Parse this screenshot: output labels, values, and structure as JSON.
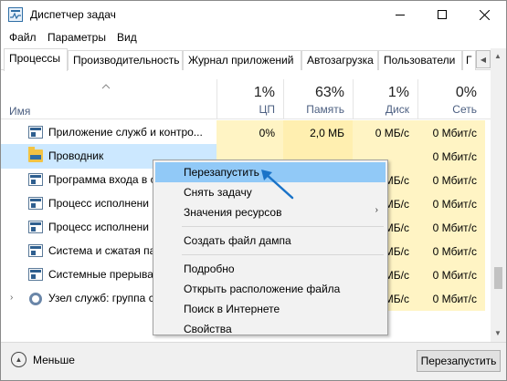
{
  "window": {
    "title": "Диспетчер задач",
    "controls": {
      "minimize": "—",
      "maximize": "☐",
      "close": "✕"
    }
  },
  "menu": {
    "items": [
      "Файл",
      "Параметры",
      "Вид"
    ]
  },
  "tabs": [
    {
      "label": "Процессы",
      "active": true
    },
    {
      "label": "Производительность",
      "active": false
    },
    {
      "label": "Журнал приложений",
      "active": false
    },
    {
      "label": "Автозагрузка",
      "active": false
    },
    {
      "label": "Пользователи",
      "active": false
    },
    {
      "label": "Г",
      "active": false
    }
  ],
  "table": {
    "name_header": "Имя",
    "columns": [
      {
        "pct": "1%",
        "label": "ЦП"
      },
      {
        "pct": "63%",
        "label": "Память"
      },
      {
        "pct": "1%",
        "label": "Диск"
      },
      {
        "pct": "0%",
        "label": "Сеть"
      }
    ],
    "rows": [
      {
        "name": "Приложение служб и контро...",
        "icon": "app-icon",
        "expander": "",
        "cpu": "0%",
        "mem": "2,0 МБ",
        "disk": "0 МБ/с",
        "net": "0 Мбит/с",
        "selected": false
      },
      {
        "name": "Проводник",
        "icon": "folder-icon",
        "expander": "",
        "cpu": "",
        "mem": "",
        "disk": "",
        "net": "0 Мбит/с",
        "selected": true
      },
      {
        "name": "Программа входа в с",
        "icon": "app-icon",
        "expander": "",
        "cpu": "",
        "mem": "",
        "disk": "0 МБ/с",
        "net": "0 Мбит/с",
        "selected": false
      },
      {
        "name": "Процесс исполнени",
        "icon": "app-icon",
        "expander": "",
        "cpu": "",
        "mem": "",
        "disk": "0 МБ/с",
        "net": "0 Мбит/с",
        "selected": false
      },
      {
        "name": "Процесс исполнени",
        "icon": "app-icon",
        "expander": "",
        "cpu": "",
        "mem": "",
        "disk": "0 МБ/с",
        "net": "0 Мбит/с",
        "selected": false
      },
      {
        "name": "Система и сжатая па",
        "icon": "app-icon",
        "expander": "",
        "cpu": "",
        "mem": "",
        "disk": "0 МБ/с",
        "net": "0 Мбит/с",
        "selected": false
      },
      {
        "name": "Системные прерыва",
        "icon": "app-icon",
        "expander": "",
        "cpu": "",
        "mem": "",
        "disk": "0 МБ/с",
        "net": "0 Мбит/с",
        "selected": false
      },
      {
        "name": "Узел служб: группа с",
        "icon": "gear-icon",
        "expander": "›",
        "cpu": "",
        "mem": "",
        "disk": "0 МБ/с",
        "net": "0 Мбит/с",
        "selected": false
      }
    ]
  },
  "context_menu": {
    "items": [
      {
        "label": "Перезапустить",
        "highlighted": true,
        "submenu": false
      },
      {
        "label": "Снять задачу",
        "highlighted": false,
        "submenu": false
      },
      {
        "label": "Значения ресурсов",
        "highlighted": false,
        "submenu": true
      },
      {
        "separator": true
      },
      {
        "label": "Создать файл дампа",
        "highlighted": false,
        "submenu": false
      },
      {
        "separator": true
      },
      {
        "label": "Подробно",
        "highlighted": false,
        "submenu": false
      },
      {
        "label": "Открыть расположение файла",
        "highlighted": false,
        "submenu": false
      },
      {
        "label": "Поиск в Интернете",
        "highlighted": false,
        "submenu": false
      },
      {
        "label": "Свойства",
        "highlighted": false,
        "submenu": false
      }
    ]
  },
  "footer": {
    "less_label": "Меньше",
    "restart_label": "Перезапустить"
  },
  "colors": {
    "selected_row": "#cce8ff",
    "menu_highlight": "#91c9f7",
    "cpu_fill": "#fff4c4",
    "mem_fill": "#ffefb0",
    "arrow": "#1a73c8"
  }
}
